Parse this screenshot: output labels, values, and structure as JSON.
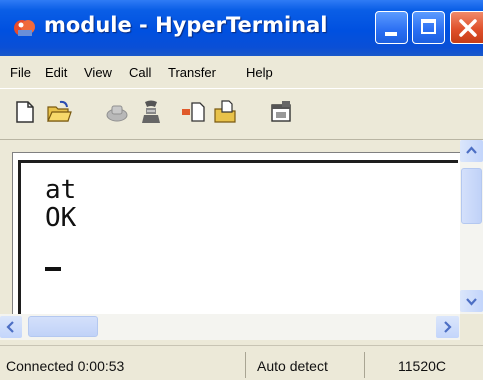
{
  "window": {
    "title": "module - HyperTerminal"
  },
  "menu": [
    "File",
    "Edit",
    "View",
    "Call",
    "Transfer",
    "Help"
  ],
  "toolbar": {
    "icons": [
      "new-connection-icon",
      "open-icon",
      "disconnect-icon",
      "dial-icon",
      "send-icon",
      "receive-icon",
      "properties-icon"
    ]
  },
  "terminal": {
    "lines": [
      "at",
      "OK"
    ],
    "cursor_visible": true
  },
  "status": {
    "connection": "Connected 0:00:53",
    "emulation": "Auto detect",
    "baud": "11520C"
  },
  "colors": {
    "titlebar": "#0050e0",
    "close_button": "#e0512c",
    "window_bg": "#ece9d8"
  }
}
